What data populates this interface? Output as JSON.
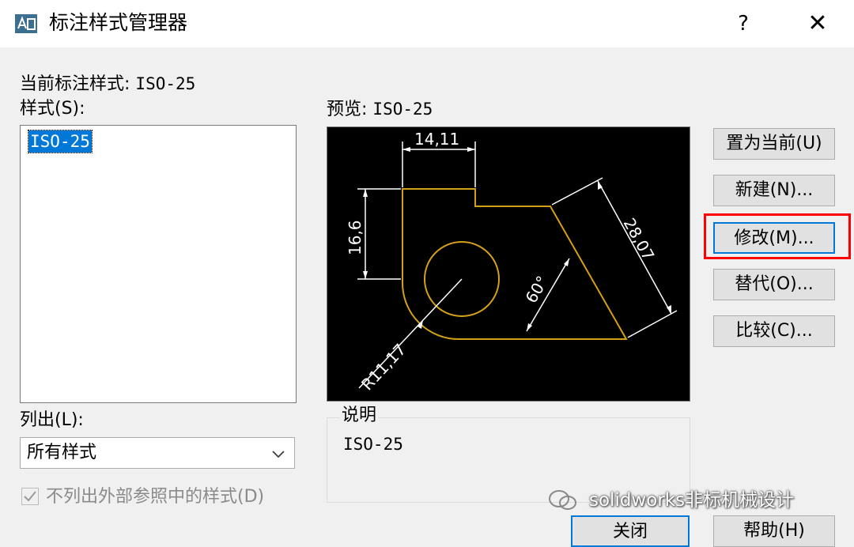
{
  "window": {
    "title": "标注样式管理器",
    "help_label": "?",
    "close_label": "✕",
    "app_icon": "dimension-style-icon"
  },
  "current_style": {
    "label": "当前标注样式:",
    "value": "ISO-25"
  },
  "styles": {
    "label": "样式(S):",
    "items": [
      "ISO-25"
    ],
    "selected": "ISO-25"
  },
  "preview": {
    "label": "预览:",
    "value": "ISO-25",
    "dims": {
      "width": "14,11",
      "height": "16,6",
      "angle": "60°",
      "aligned": "28,07",
      "radius": "R11,17"
    },
    "geometry_color": "#d4a017",
    "dim_color": "#ffffff"
  },
  "buttons": {
    "set_current": "置为当前(U)",
    "new": "新建(N)...",
    "modify": "修改(M)...",
    "override": "替代(O)...",
    "compare": "比较(C)...",
    "close": "关闭",
    "help": "帮助(H)"
  },
  "list": {
    "label": "列出(L):",
    "selected": "所有样式"
  },
  "xref_checkbox": {
    "label": "不列出外部参照中的样式(D)",
    "checked": true
  },
  "description": {
    "label": "说明",
    "value": "ISO-25"
  },
  "watermark": {
    "text": "solidworks非标机械设计"
  },
  "colors": {
    "accent": "#0078d7",
    "highlight": "#ff0000",
    "dialog_bg": "#f0f0f0"
  }
}
